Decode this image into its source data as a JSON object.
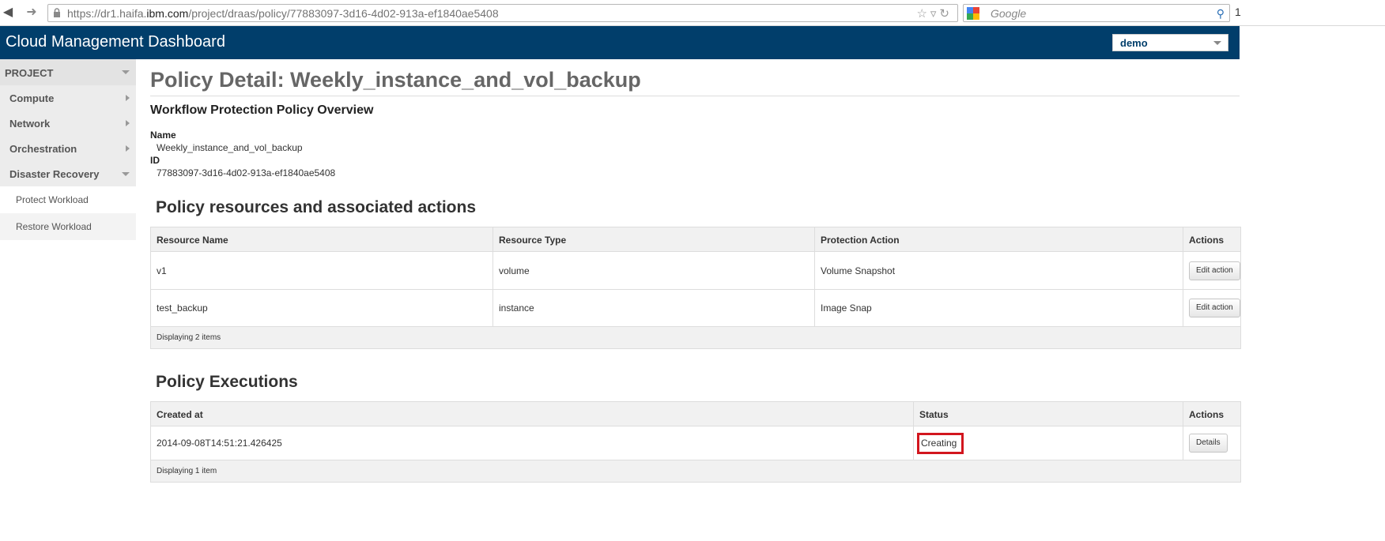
{
  "browser": {
    "url_prefix": "https://dr1.haifa.",
    "url_domain": "ibm.com",
    "url_path": "/project/draas/policy/77883097-3d16-4d02-913a-ef1840ae5408",
    "search_placeholder": "Google",
    "edge_char": "1"
  },
  "header": {
    "title": "Cloud Management Dashboard",
    "project_selected": "demo"
  },
  "sidebar": {
    "section": "PROJECT",
    "items": [
      {
        "label": "Compute"
      },
      {
        "label": "Network"
      },
      {
        "label": "Orchestration"
      },
      {
        "label": "Disaster Recovery"
      }
    ],
    "subitems": [
      {
        "label": "Protect Workload"
      },
      {
        "label": "Restore Workload"
      }
    ]
  },
  "main": {
    "title": "Policy Detail: Weekly_instance_and_vol_backup",
    "overview_heading": "Workflow Protection Policy Overview",
    "name_label": "Name",
    "name_value": "Weekly_instance_and_vol_backup",
    "id_label": "ID",
    "id_value": "77883097-3d16-4d02-913a-ef1840ae5408",
    "resources": {
      "heading": "Policy resources and associated actions",
      "columns": [
        "Resource Name",
        "Resource Type",
        "Protection Action",
        "Actions"
      ],
      "rows": [
        {
          "name": "v1",
          "type": "volume",
          "action": "Volume Snapshot",
          "button": "Edit action"
        },
        {
          "name": "test_backup",
          "type": "instance",
          "action": "Image Snap",
          "button": "Edit action"
        }
      ],
      "footer": "Displaying 2 items"
    },
    "executions": {
      "heading": "Policy Executions",
      "columns": [
        "Created at",
        "Status",
        "Actions"
      ],
      "rows": [
        {
          "created": "2014-09-08T14:51:21.426425",
          "status": "Creating",
          "button": "Details"
        }
      ],
      "footer": "Displaying 1 item"
    }
  },
  "colors": {
    "header_bg": "#013e6b",
    "status_highlight": "#d2161e"
  }
}
